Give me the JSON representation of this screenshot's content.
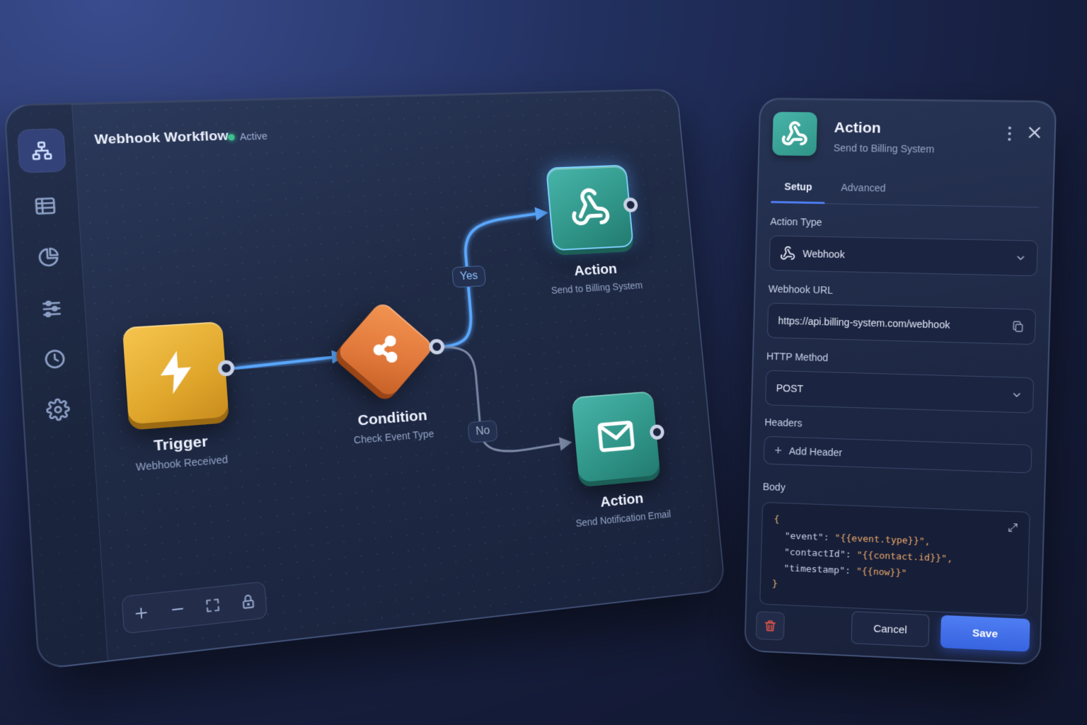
{
  "workflow": {
    "title": "Webhook Workflow",
    "status": "Active",
    "status_color": "#3cc28f"
  },
  "sidebar": {
    "items": [
      {
        "icon": "workflow-tree-icon",
        "active": true
      },
      {
        "icon": "table-icon",
        "active": false
      },
      {
        "icon": "pie-chart-icon",
        "active": false
      },
      {
        "icon": "sliders-icon",
        "active": false
      },
      {
        "icon": "clock-icon",
        "active": false
      },
      {
        "icon": "gear-icon",
        "active": false
      }
    ]
  },
  "nodes": {
    "trigger": {
      "title": "Trigger",
      "subtitle": "Webhook Received",
      "icon": "lightning-icon",
      "color": "#e6ad34"
    },
    "condition": {
      "title": "Condition",
      "subtitle": "Check Event Type",
      "icon": "branch-icon",
      "color": "#e57f3f"
    },
    "action_billing": {
      "title": "Action",
      "subtitle": "Send to Billing System",
      "icon": "webhook-icon",
      "color": "#36a094"
    },
    "action_email": {
      "title": "Action",
      "subtitle": "Send Notification Email",
      "icon": "mail-icon",
      "color": "#36a094"
    }
  },
  "edges": {
    "yes_label": "Yes",
    "no_label": "No",
    "highlight_color": "#5aa8ff"
  },
  "zoom_controls": [
    "zoom-in",
    "zoom-out",
    "fit-view",
    "lock"
  ],
  "panel": {
    "title": "Action",
    "subtitle": "Send to Billing System",
    "icon": "webhook-icon",
    "tabs": [
      {
        "label": "Setup",
        "active": true
      },
      {
        "label": "Advanced",
        "active": false
      }
    ],
    "action_type": {
      "label": "Action Type",
      "value": "Webhook"
    },
    "webhook_url": {
      "label": "Webhook URL",
      "value": "https://api.billing-system.com/webhook"
    },
    "http_method": {
      "label": "HTTP Method",
      "value": "POST"
    },
    "headers": {
      "label": "Headers",
      "add_label": "Add Header"
    },
    "body": {
      "label": "Body",
      "open_brace": "{",
      "close_brace": "}",
      "lines": [
        {
          "key": "\"event\"",
          "value": "\"{{event.type}}\","
        },
        {
          "key": "\"contactId\"",
          "value": "\"{{contact.id}}\","
        },
        {
          "key": "\"timestamp\"",
          "value": "\"{{now}}\""
        }
      ]
    },
    "cancel_label": "Cancel",
    "save_label": "Save",
    "accent_color": "#4d7cf0",
    "danger_color": "#e6544b"
  }
}
